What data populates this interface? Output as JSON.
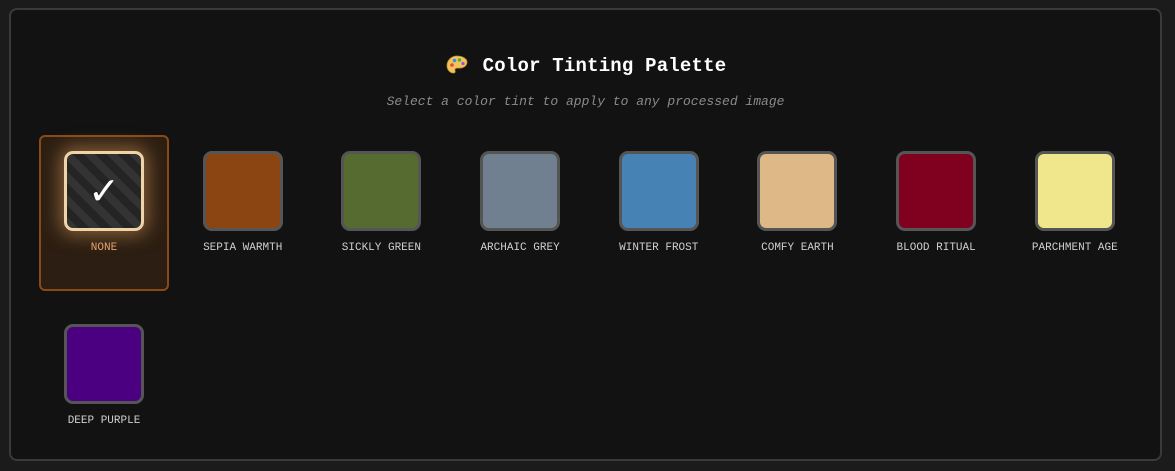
{
  "header": {
    "title": "Color Tinting Palette",
    "subtitle": "Select a color tint to apply to any processed image",
    "icon": "palette-icon"
  },
  "tints": [
    {
      "label": "NONE",
      "color": null,
      "selected": true,
      "check_glyph": "✓"
    },
    {
      "label": "SEPIA WARMTH",
      "color": "#8b4513"
    },
    {
      "label": "SICKLY GREEN",
      "color": "#556b2f"
    },
    {
      "label": "ARCHAIC GREY",
      "color": "#708090"
    },
    {
      "label": "WINTER FROST",
      "color": "#4682b4"
    },
    {
      "label": "COMFY EARTH",
      "color": "#deb887"
    },
    {
      "label": "BLOOD RITUAL",
      "color": "#800020"
    },
    {
      "label": "PARCHMENT AGE",
      "color": "#f0e68c"
    },
    {
      "label": "DEEP PURPLE",
      "color": "#4b0082"
    }
  ],
  "colors": {
    "selected_border": "#8a4a16",
    "selected_label": "#e6a570",
    "panel_background": "#121212"
  }
}
